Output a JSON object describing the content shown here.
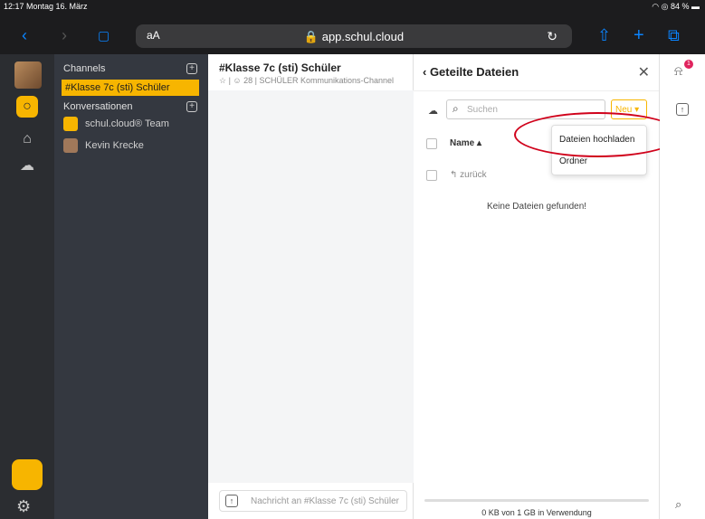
{
  "status": {
    "time_date": "12:17  Montag 16. März",
    "right": "◠ ◎ 84 % ▬"
  },
  "browser": {
    "back": "‹",
    "forward": "›",
    "bookmarks": "▢",
    "aa": "aA",
    "url": "🔒 app.schul.cloud",
    "reload": "↻",
    "share": "⇧",
    "add": "+",
    "tabs": "⧉"
  },
  "sidebar": {
    "channels_label": "Channels",
    "active_channel": "#Klasse 7c (sti) Schüler",
    "conversations_label": "Konversationen",
    "items": [
      {
        "label": "schul.cloud® Team"
      },
      {
        "label": "Kevin Krecke"
      }
    ],
    "plus": "+"
  },
  "channel": {
    "title": "#Klasse 7c (sti) Schüler",
    "subtitle": "☆ | ☺ 28 | SCHÜLER Kommunikations-Channel",
    "compose_placeholder": "Nachricht an #Klasse 7c (sti) Schüler",
    "upload_icon": "↑"
  },
  "files": {
    "title": "‹ Geteilte Dateien",
    "close": "✕",
    "cloud_icon": "☁",
    "search_icon": "⌕",
    "search_placeholder": "Suchen",
    "new_button": "Neu ▾",
    "column_name": "Name ▴",
    "back_label": "↰ zurück",
    "empty_text": "Keine Dateien gefunden!",
    "usage": "0 KB von 1 GB in Verwendung"
  },
  "dropdown": {
    "upload": "Dateien hochladen",
    "folder": "Ordner"
  },
  "rail": {
    "chat": "○",
    "people": "⌂",
    "cloud": "☁",
    "gear": "⚙"
  },
  "right_rail": {
    "bell": "⍾",
    "badge": "1",
    "upload": "↑",
    "search": "⌕"
  },
  "colors": {
    "accent": "#f7b500",
    "annotation": "#d0021b"
  }
}
